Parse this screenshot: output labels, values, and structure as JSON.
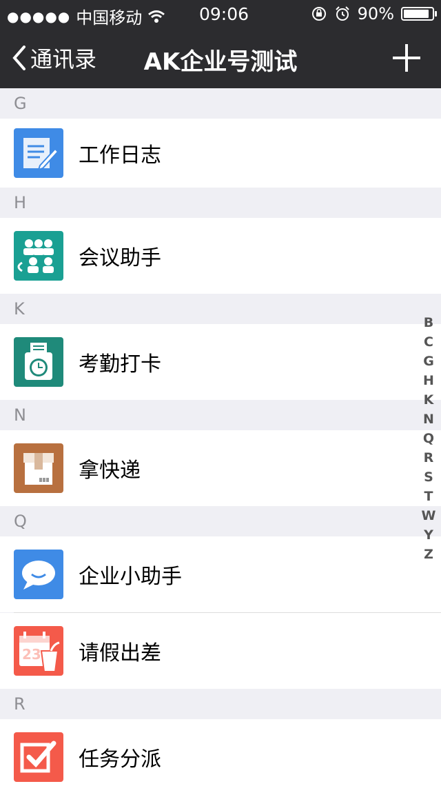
{
  "status": {
    "carrier": "中国移动",
    "time": "09:06",
    "battery_text": "90%",
    "battery_level": 0.9
  },
  "nav": {
    "back_label": "通讯录",
    "title": "AK企业号测试"
  },
  "sections": [
    {
      "letter": "G",
      "items": [
        {
          "label": "工作日志"
        }
      ]
    },
    {
      "letter": "H",
      "items": [
        {
          "label": "会议助手"
        }
      ]
    },
    {
      "letter": "K",
      "items": [
        {
          "label": "考勤打卡"
        }
      ]
    },
    {
      "letter": "N",
      "items": [
        {
          "label": "拿快递"
        }
      ]
    },
    {
      "letter": "Q",
      "items": [
        {
          "label": "企业小助手"
        },
        {
          "label": "请假出差"
        }
      ]
    },
    {
      "letter": "R",
      "items": [
        {
          "label": "任务分派"
        }
      ]
    }
  ],
  "index_letters": [
    "B",
    "C",
    "G",
    "H",
    "K",
    "N",
    "Q",
    "R",
    "S",
    "T",
    "W",
    "Y",
    "Z"
  ],
  "colors": {
    "nav_bg": "#2c2c2f",
    "log_icon": "#3f8be6",
    "meeting_icon": "#1aa093",
    "attendance_icon": "#1f8a7a",
    "express_icon": "#b8703f",
    "assistant_icon": "#3f8be6",
    "leave_icon": "#f45a4a",
    "task_icon": "#f45a4a"
  }
}
